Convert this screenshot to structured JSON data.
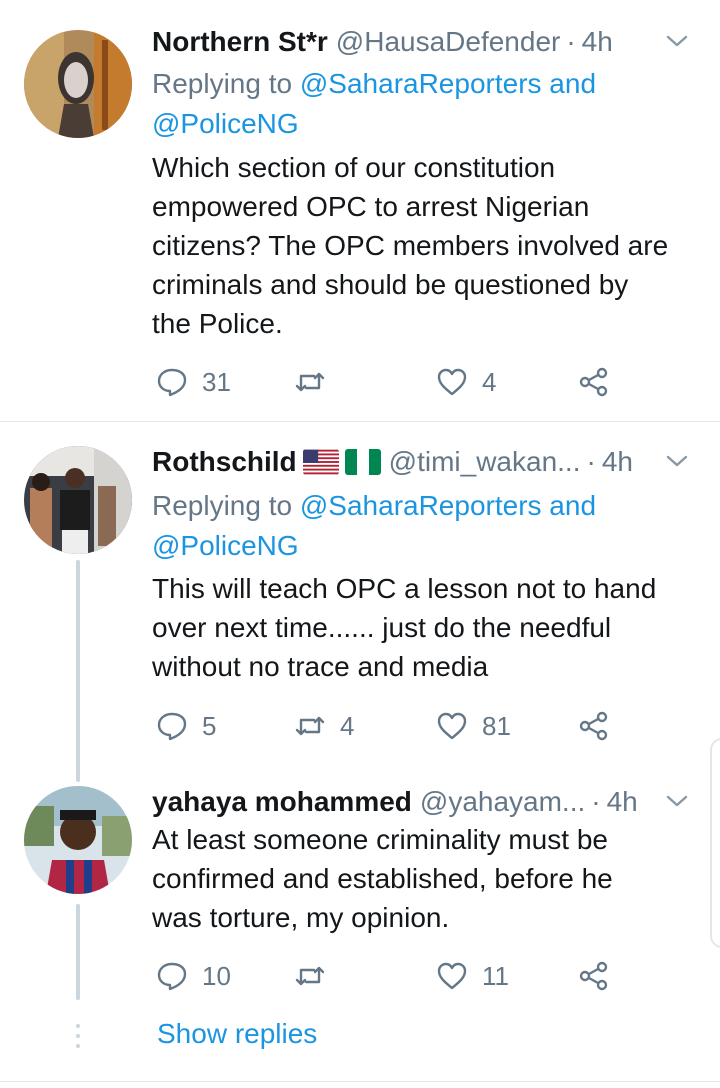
{
  "tweets": [
    {
      "name": "Northern St*r",
      "handle": "@HausaDefender",
      "time": "4h",
      "replying_prefix": "Replying to ",
      "replying_line1": "@SaharaReporters and",
      "replying_line2": "@PoliceNG",
      "body": [
        "Which section of our constitution",
        "empowered OPC to arrest Nigerian",
        "citizens? The OPC members involved are",
        "criminals and should be questioned by",
        "the Police."
      ],
      "replies": "31",
      "retweets": "",
      "likes": "4"
    },
    {
      "name": "Rothschild",
      "handle": "@timi_wakan...",
      "time": "4h",
      "replying_prefix": "Replying to ",
      "replying_line1": "@SaharaReporters and",
      "replying_line2": "@PoliceNG",
      "body": [
        "This will teach OPC a lesson not to hand",
        "over next time...... just do the needful",
        "without no trace and media"
      ],
      "replies": "5",
      "retweets": "4",
      "likes": "81"
    },
    {
      "name": "yahaya mohammed",
      "handle": "@yahayam...",
      "time": "4h",
      "body": [
        "At least someone criminality must be",
        "confirmed and established, before he",
        "was torture, my opinion."
      ],
      "replies": "10",
      "retweets": "",
      "likes": "11"
    }
  ],
  "separator": "·",
  "show_replies": "Show replies",
  "icons": {
    "reply": "reply-icon",
    "retweet": "retweet-icon",
    "like": "heart-icon",
    "share": "share-icon",
    "more": "chevron-down-icon",
    "flags": [
      "us-flag-icon",
      "nigeria-flag-icon"
    ]
  },
  "colors": {
    "text": "#14171a",
    "muted": "#657786",
    "link": "#1b95e0",
    "divider": "#e1e8ed",
    "thread": "#ccd6dd"
  }
}
